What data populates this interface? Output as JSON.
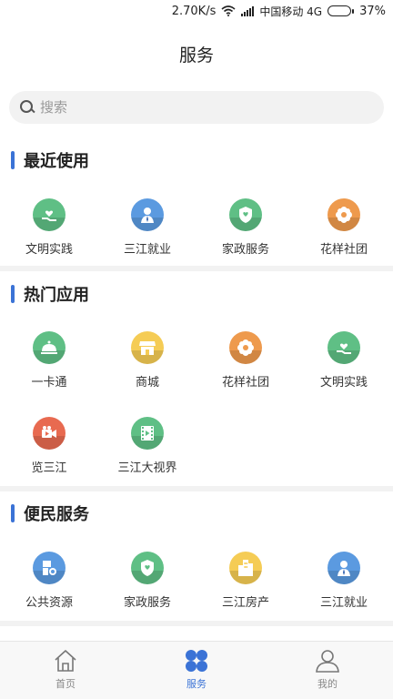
{
  "status_bar": {
    "speed": "2.70K/s",
    "carrier": "中国移动 4G",
    "battery": "37%"
  },
  "header": {
    "title": "服务"
  },
  "search": {
    "placeholder": "搜索"
  },
  "sections": [
    {
      "title": "最近使用",
      "items": [
        {
          "label": "文明实践",
          "icon": "hand-heart-icon",
          "color": "#5fbf85"
        },
        {
          "label": "三江就业",
          "icon": "person-tie-icon",
          "color": "#5b9ae0"
        },
        {
          "label": "家政服务",
          "icon": "heart-shield-icon",
          "color": "#5fbf85"
        },
        {
          "label": "花样社团",
          "icon": "flower-icon",
          "color": "#ee9a4d"
        }
      ]
    },
    {
      "title": "热门应用",
      "items": [
        {
          "label": "一卡通",
          "icon": "cloche-icon",
          "color": "#5fbf85"
        },
        {
          "label": "商城",
          "icon": "shop-icon",
          "color": "#f5cc55"
        },
        {
          "label": "花样社团",
          "icon": "flower-icon",
          "color": "#ee9a4d"
        },
        {
          "label": "文明实践",
          "icon": "hand-heart-icon",
          "color": "#5fbf85"
        },
        {
          "label": "览三江",
          "icon": "video-camera-icon",
          "color": "#e86a50"
        },
        {
          "label": "三江大视界",
          "icon": "film-icon",
          "color": "#5fbf85"
        }
      ]
    },
    {
      "title": "便民服务",
      "items": [
        {
          "label": "公共资源",
          "icon": "resource-icon",
          "color": "#5b9ae0"
        },
        {
          "label": "家政服务",
          "icon": "heart-shield-icon",
          "color": "#5fbf85"
        },
        {
          "label": "三江房产",
          "icon": "buildings-icon",
          "color": "#f5cc55"
        },
        {
          "label": "三江就业",
          "icon": "person-tie-icon",
          "color": "#5b9ae0"
        }
      ]
    }
  ],
  "tabbar": [
    {
      "label": "首页",
      "icon": "home-icon",
      "active": false
    },
    {
      "label": "服务",
      "icon": "grid-icon",
      "active": true
    },
    {
      "label": "我的",
      "icon": "user-icon",
      "active": false
    }
  ],
  "colors": {
    "accent": "#3b73d6",
    "divider": "#f2f2f2",
    "tab_inactive": "#888888"
  }
}
